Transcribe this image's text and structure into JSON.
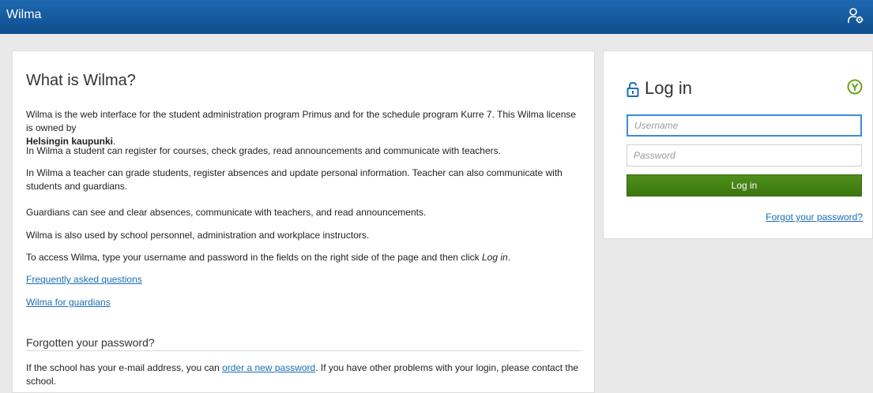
{
  "header": {
    "app_title": "Wilma",
    "account_icon": "user-settings-icon"
  },
  "info": {
    "title": "What is Wilma?",
    "intro": "Wilma is the web interface for the student administration program Primus and for the schedule program Kurre 7. This Wilma license is owned by",
    "owner": "Helsingin kaupunki",
    "owner_suffix": ".",
    "student": "In Wilma a student can register for courses, check grades, read announcements and communicate with teachers.",
    "teacher": "In Wilma a teacher can grade students, register absences and update personal information. Teacher can also communicate with students and guardians.",
    "guardian": "Guardians can see and clear absences, communicate with teachers, and read announcements.",
    "personnel": "Wilma is also used by school personnel, administration and workplace instructors.",
    "access_prefix": "To access Wilma, type your username and password in the fields on the right side of the page and then click ",
    "access_emph": "Log in",
    "access_suffix": ".",
    "faq_link": "Frequently asked questions",
    "guardians_link": "Wilma for guardians",
    "forgot_heading": "Forgotten your password?",
    "forgot_prefix": "If the school has your e-mail address, you can ",
    "forgot_link": "order a new password",
    "forgot_suffix": ". If you have other problems with your login, please contact the school."
  },
  "login": {
    "title": "Log in",
    "lock_icon": "lock-icon",
    "brand_icon": "visma-logo-icon",
    "username_placeholder": "Username",
    "username_value": "",
    "password_placeholder": "Password",
    "password_value": "",
    "button_label": "Log in",
    "forgot_link": "Forgot your password?"
  },
  "colors": {
    "header": "#0f4e8e",
    "button": "#3b760f",
    "link": "#1a6eb5"
  }
}
